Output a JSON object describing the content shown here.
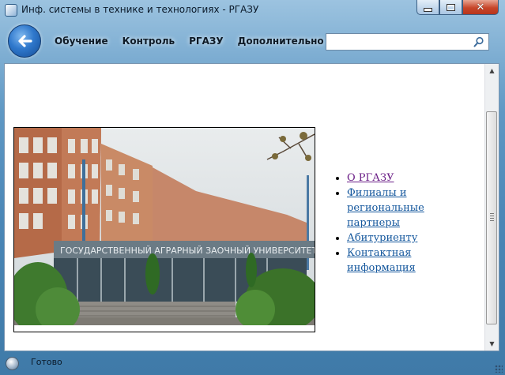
{
  "window": {
    "title": "Инф. системы в технике и технологиях - РГАЗУ"
  },
  "nav": {
    "menu": [
      {
        "label": "Обучение"
      },
      {
        "label": "Контроль"
      },
      {
        "label": "РГАЗУ"
      },
      {
        "label": "Дополнительно"
      }
    ],
    "search": {
      "value": "",
      "placeholder": ""
    }
  },
  "content": {
    "photo_caption": "ГОСУДАРСТВЕННЫЙ АГРАРНЫЙ ЗАОЧНЫЙ УНИВЕРСИТЕТ",
    "links": [
      {
        "label": "О РГАЗУ",
        "visited": true
      },
      {
        "label": "Филиалы и региональные партнеры",
        "visited": false
      },
      {
        "label": "Абитуриенту",
        "visited": false
      },
      {
        "label": "Контактная информация",
        "visited": false
      }
    ]
  },
  "status": {
    "text": "Готово"
  },
  "colors": {
    "link": "#14579d",
    "visited_link": "#6a1d86",
    "chrome": "#4a86b6"
  }
}
